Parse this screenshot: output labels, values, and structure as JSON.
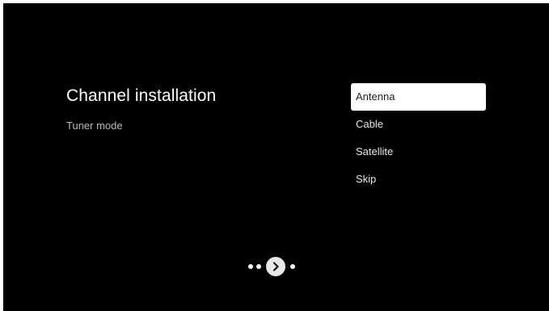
{
  "screen": {
    "title": "Channel installation",
    "subtitle": "Tuner mode"
  },
  "options": [
    {
      "label": "Antenna",
      "selected": true
    },
    {
      "label": "Cable",
      "selected": false
    },
    {
      "label": "Satellite",
      "selected": false
    },
    {
      "label": "Skip",
      "selected": false
    }
  ],
  "pager": {
    "icon": "chevron-right-icon",
    "button_color": "#e8e8e8",
    "dot_color": "#ffffff"
  },
  "colors": {
    "background": "#000000",
    "selected_bg": "#ffffff",
    "selected_text": "#222222"
  }
}
